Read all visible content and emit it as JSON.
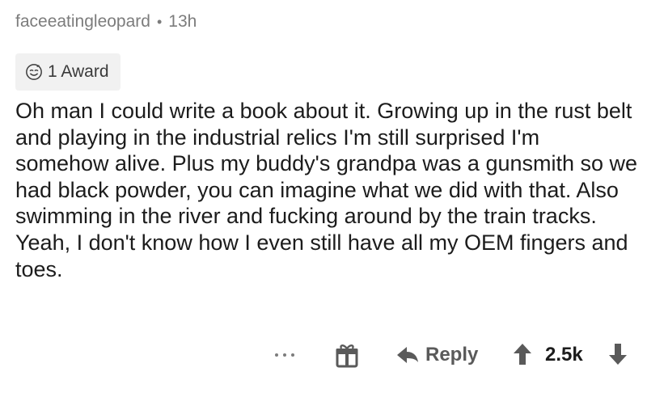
{
  "comment": {
    "author": "faceeatingleopard",
    "separator": "•",
    "age": "13h",
    "award_label": "1 Award",
    "body": "Oh man I could write a book about it.  Growing up in the rust belt and playing in the industrial relics I'm still surprised I'm somehow alive.  Plus my buddy's grandpa was a gunsmith so we had black powder, you can imagine what we did with that.  Also swimming in the river and fucking around by the train tracks.  Yeah, I don't know how I even still have all my OEM fingers and toes."
  },
  "actions": {
    "reply_label": "Reply",
    "score": "2.5k",
    "icons": [
      "more-icon",
      "gift-icon",
      "reply-icon",
      "upvote-icon",
      "downvote-icon"
    ]
  },
  "colors": {
    "meta_text": "#7c7c7c",
    "award_bg": "#f1f1f1",
    "icon_gray": "#5a5a5a"
  }
}
